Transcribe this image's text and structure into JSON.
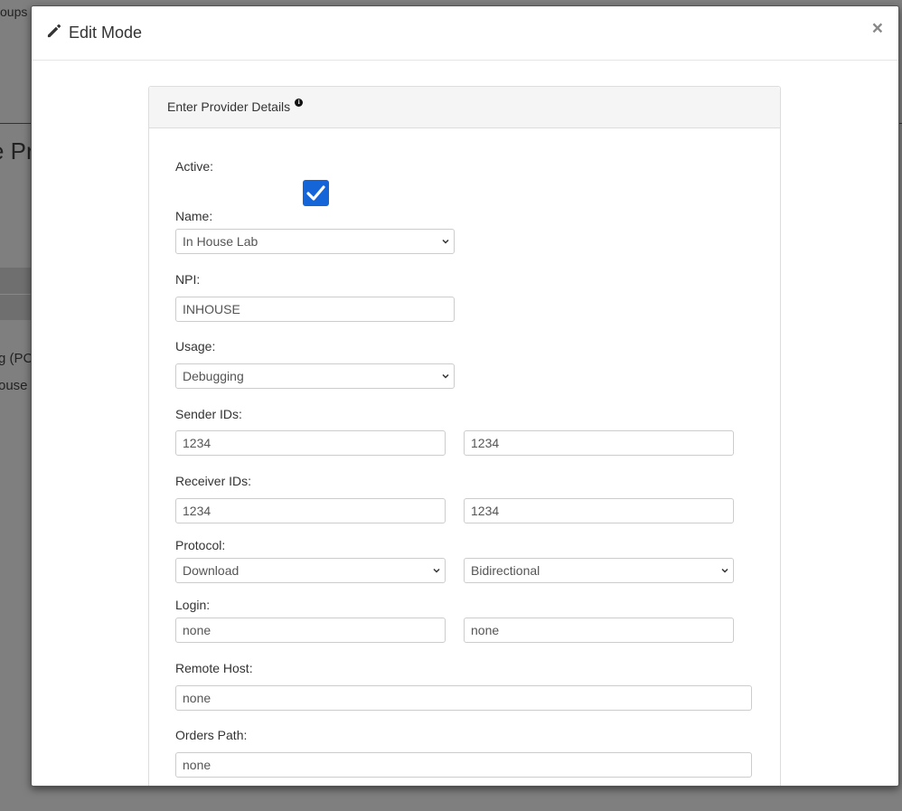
{
  "background": {
    "fragment_1": "oups",
    "fragment_2": "e Pr",
    "fragment_3": "g (PC",
    "fragment_4": "ouse"
  },
  "modal": {
    "title": "Edit Mode",
    "title_icon": "pencil-icon",
    "close_label": "×",
    "panel_title": "Enter Provider Details",
    "info_icon_label": "i"
  },
  "form": {
    "active": {
      "label": "Active:",
      "checked": true
    },
    "name": {
      "label": "Name:",
      "value": "In House Lab"
    },
    "npi": {
      "label": "NPI:",
      "value": "INHOUSE"
    },
    "usage": {
      "label": "Usage:",
      "value": "Debugging"
    },
    "sender_ids": {
      "label": "Sender IDs:",
      "value_1": "1234",
      "value_2": "1234"
    },
    "receiver_ids": {
      "label": "Receiver IDs:",
      "value_1": "1234",
      "value_2": "1234"
    },
    "protocol": {
      "label": "Protocol:",
      "value_1": "Download",
      "value_2": "Bidirectional"
    },
    "login": {
      "label": "Login:",
      "value_1": "none",
      "value_2": "none"
    },
    "remote_host": {
      "label": "Remote Host:",
      "value": "none"
    },
    "orders_path": {
      "label": "Orders Path:",
      "value": "none"
    }
  },
  "colors": {
    "checkbox": "#1565d8",
    "overlay": "#7f7f7f"
  }
}
